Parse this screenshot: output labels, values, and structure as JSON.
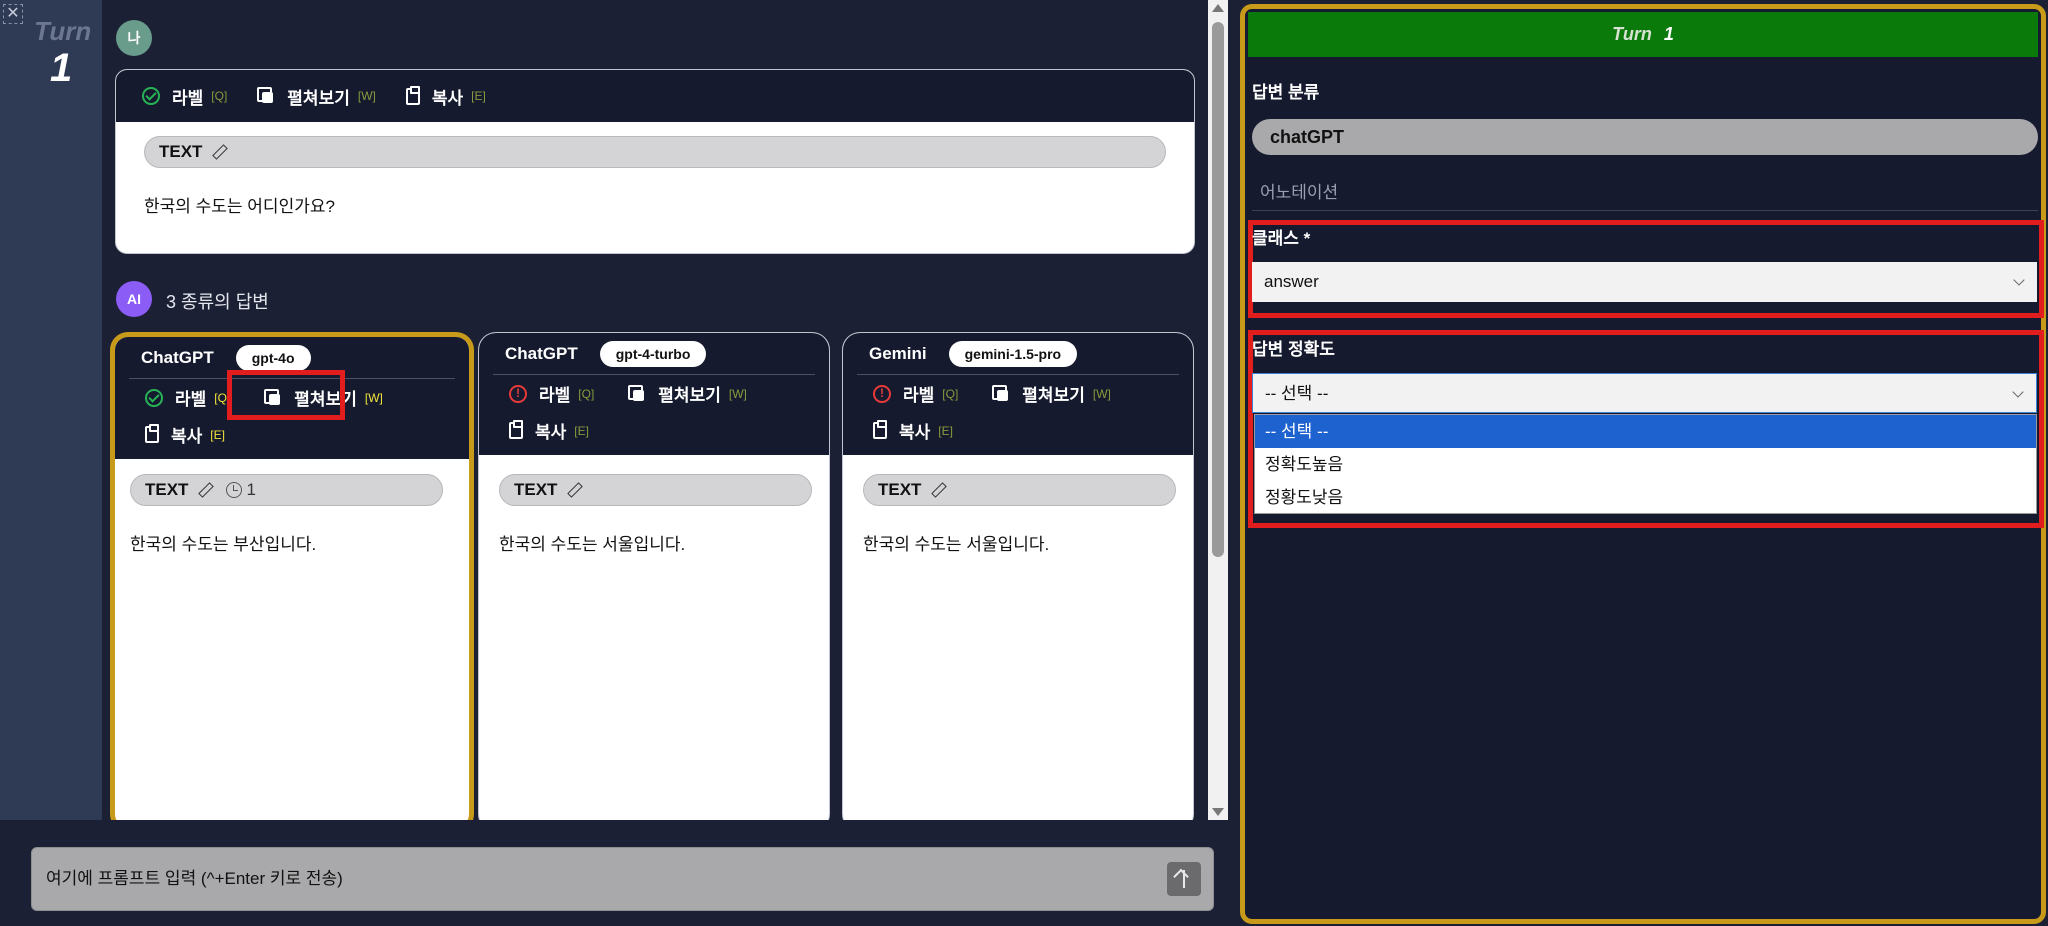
{
  "close_glyph": "✕",
  "turn": {
    "word": "Turn",
    "number": "1"
  },
  "user": {
    "avatar": "나",
    "toolbar": {
      "label": "라벨",
      "label_key": "[Q]",
      "expand": "펼쳐보기",
      "expand_key": "[W]",
      "copy": "복사",
      "copy_key": "[E]"
    },
    "text_tag": "TEXT",
    "message": "한국의 수도는 어디인가요?"
  },
  "ai": {
    "avatar": "AI",
    "count_label": "3 종류의 답변",
    "answers": [
      {
        "title": "ChatGPT",
        "model": "gpt-4o",
        "label": "라벨",
        "label_key": "[Q]",
        "expand": "펼쳐보기",
        "expand_key": "[W]",
        "copy": "복사",
        "copy_key": "[E]",
        "text_tag": "TEXT",
        "history_count": "1",
        "message": "한국의 수도는 부산입니다.",
        "status": "check-icon"
      },
      {
        "title": "ChatGPT",
        "model": "gpt-4-turbo",
        "label": "라벨",
        "label_key": "[Q]",
        "expand": "펼쳐보기",
        "expand_key": "[W]",
        "copy": "복사",
        "copy_key": "[E]",
        "text_tag": "TEXT",
        "message": "한국의 수도는 서울입니다.",
        "status": "alert-icon"
      },
      {
        "title": "Gemini",
        "model": "gemini-1.5-pro",
        "label": "라벨",
        "label_key": "[Q]",
        "expand": "펼쳐보기",
        "expand_key": "[W]",
        "copy": "복사",
        "copy_key": "[E]",
        "text_tag": "TEXT",
        "message": "한국의 수도는 서울입니다.",
        "status": "alert-icon"
      }
    ]
  },
  "prompt": {
    "placeholder": "여기에 프롬프트 입력 (^+Enter 키로 전송)"
  },
  "panel": {
    "turn_word": "Turn",
    "turn_number": "1",
    "classification_label": "답변 분류",
    "selected_source": "chatGPT",
    "annotation_label": "어노테이션",
    "class_label": "클래스 *",
    "class_value": "answer",
    "accuracy_label": "답변 정확도",
    "accuracy_value": "-- 선택 --",
    "accuracy_options": [
      "-- 선택 --",
      "정확도높음",
      "정황도낮음"
    ]
  },
  "colors": {
    "accent_gold": "#c89a1a",
    "banner_green": "#0a7a0a",
    "highlight_red": "#e11d1d",
    "option_selected": "#1e62d0"
  }
}
